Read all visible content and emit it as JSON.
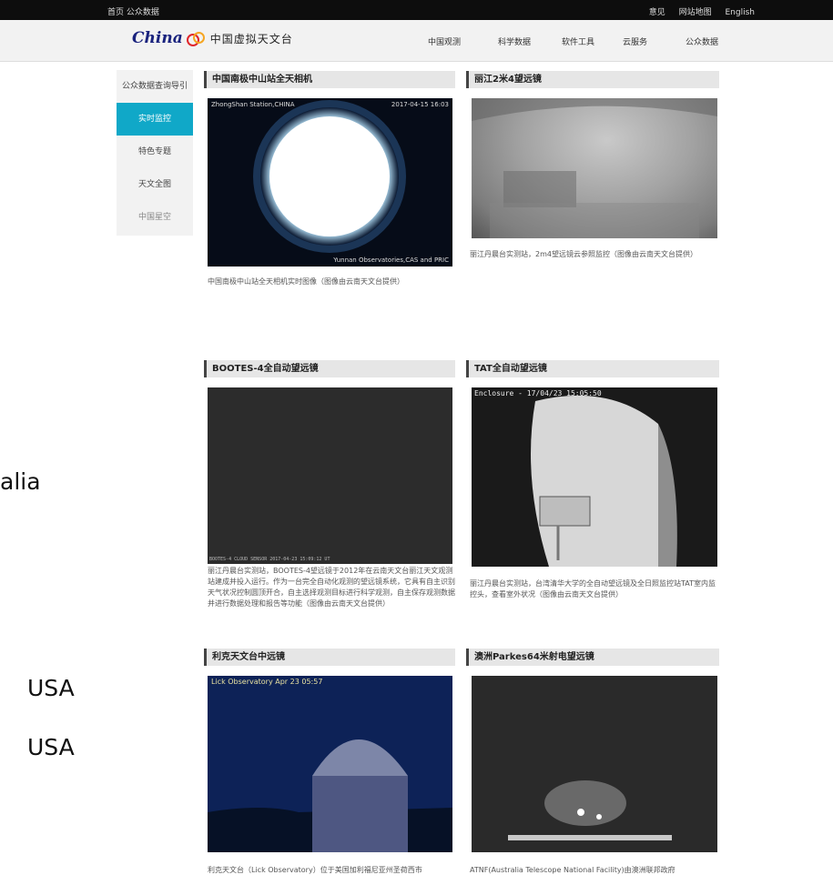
{
  "topbar": {
    "left": "首页 公众数据",
    "right": [
      "意见",
      "网站地图",
      "English"
    ]
  },
  "header": {
    "logo_text": "China",
    "site_name": "中国虚拟天文台",
    "nav": [
      "中国观测",
      "科学数据",
      "软件工具",
      "云服务",
      "公众数据"
    ]
  },
  "sidebar": {
    "items": [
      {
        "label": "公众数据查询导引"
      },
      {
        "label": "实时监控"
      },
      {
        "label": "特色专题"
      },
      {
        "label": "天文全图"
      },
      {
        "label": "中国星空"
      }
    ]
  },
  "cards": [
    {
      "title": "中国南极中山站全天相机",
      "overlay_left": "ZhongShan Station,CHINA",
      "overlay_right": "2017-04-15 16:03",
      "overlay_bottom": "Yunnan Observatories,CAS and PRIC",
      "caption": "中国南极中山站全天相机实时图像（图像由云南天文台提供）"
    },
    {
      "title": "丽江2米4望远镜",
      "caption": "丽江丹晨台实测站，2m4望远镜云参照监控（图像由云南天文台提供）"
    },
    {
      "title": "BOOTES-4全自动望远镜",
      "overlay_bottom": "BOOTES-4 CLOUD SENSOR  2017-04-23 15:09:12 UT",
      "caption": "丽江丹晨台实测站，BOOTES-4望远镜于2012年在云南天文台丽江天文观测站建成并投入运行。作为一台完全自动化观测的望远镜系统，它具有自主识别天气状况控制圆顶开合，自主选择观测目标进行科学观测，自主保存观测数据并进行数据处理和报告等功能（图像由云南天文台提供）"
    },
    {
      "title": "TAT全自动望远镜",
      "overlay_left": "Enclosure - 17/04/23 15:05:50",
      "caption": "丽江丹晨台实测站，台湾清华大学的全自动望远镜及全日照监控站TAT室内监控头，查看室外状况（图像由云南天文台提供）"
    },
    {
      "title": "利克天文台中远镜",
      "overlay_left": "Lick Observatory  Apr 23 05:57",
      "caption": "利克天文台（Lick Observatory）位于美国加利福尼亚州圣荷西市"
    },
    {
      "title": "澳洲Parkes64米射电望远镜",
      "caption": "ATNF(Australia Telescope National Facility)由澳洲联邦政府"
    }
  ],
  "background_text": [
    "alia",
    "USA",
    "USA"
  ]
}
